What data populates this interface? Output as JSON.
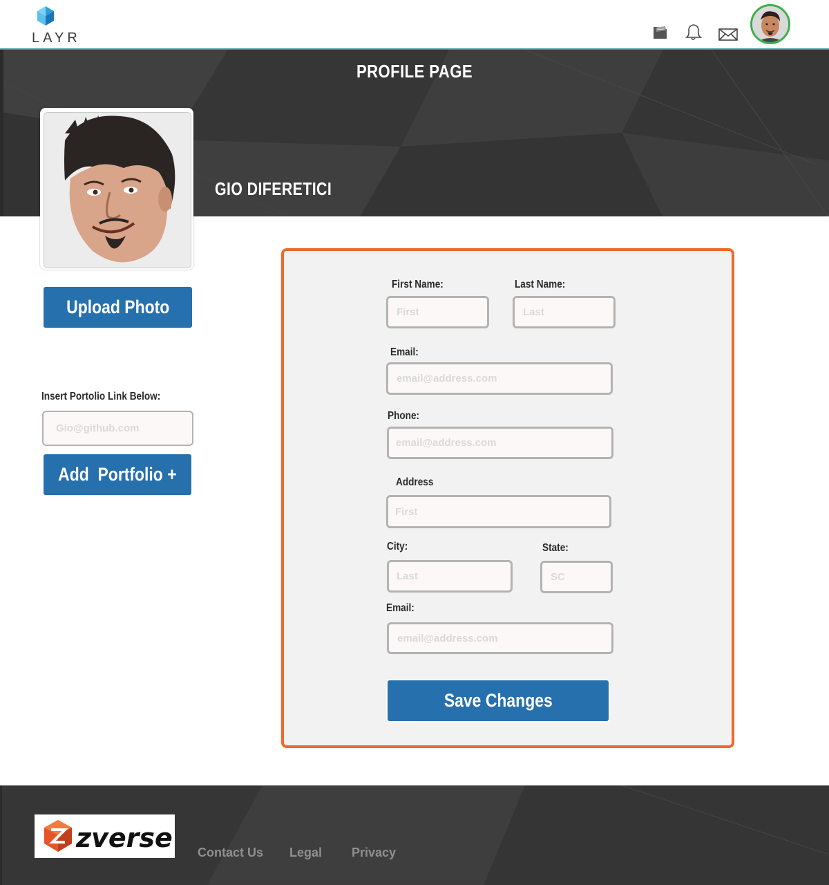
{
  "header": {
    "logo_text": "LAYR",
    "icons": [
      "folder-icon",
      "bell-icon",
      "mail-icon"
    ],
    "accent_ring_color": "#3cae4a"
  },
  "banner": {
    "page_title": "PROFILE PAGE",
    "user_name": "GIO DIFERETICI"
  },
  "sidebar": {
    "upload_photo_label": "Upload Photo",
    "portfolio_label": "Insert Portolio Link Below:",
    "portfolio_placeholder": "Gio@github.com",
    "add_portfolio_label": "Add  Portfolio +"
  },
  "form": {
    "first_name": {
      "label": "First Name:",
      "placeholder": "First"
    },
    "last_name": {
      "label": "Last Name:",
      "placeholder": "Last"
    },
    "email": {
      "label": "Email:",
      "placeholder": "email@address.com"
    },
    "phone": {
      "label": "Phone:",
      "placeholder": "email@address.com"
    },
    "address": {
      "label": "Address",
      "placeholder": "First"
    },
    "city": {
      "label": "City:",
      "placeholder": "Last"
    },
    "state": {
      "label": "State:",
      "placeholder": "SC"
    },
    "email2": {
      "label": "Email:",
      "placeholder": "email@address.com"
    },
    "save_label": "Save Changes",
    "border_color": "#ee6a29"
  },
  "footer": {
    "brand": "zverse",
    "links": [
      "Contact Us",
      "Legal",
      "Privacy"
    ]
  },
  "colors": {
    "primary_button": "#2670ad",
    "banner_bg": "#3a3a3a"
  }
}
